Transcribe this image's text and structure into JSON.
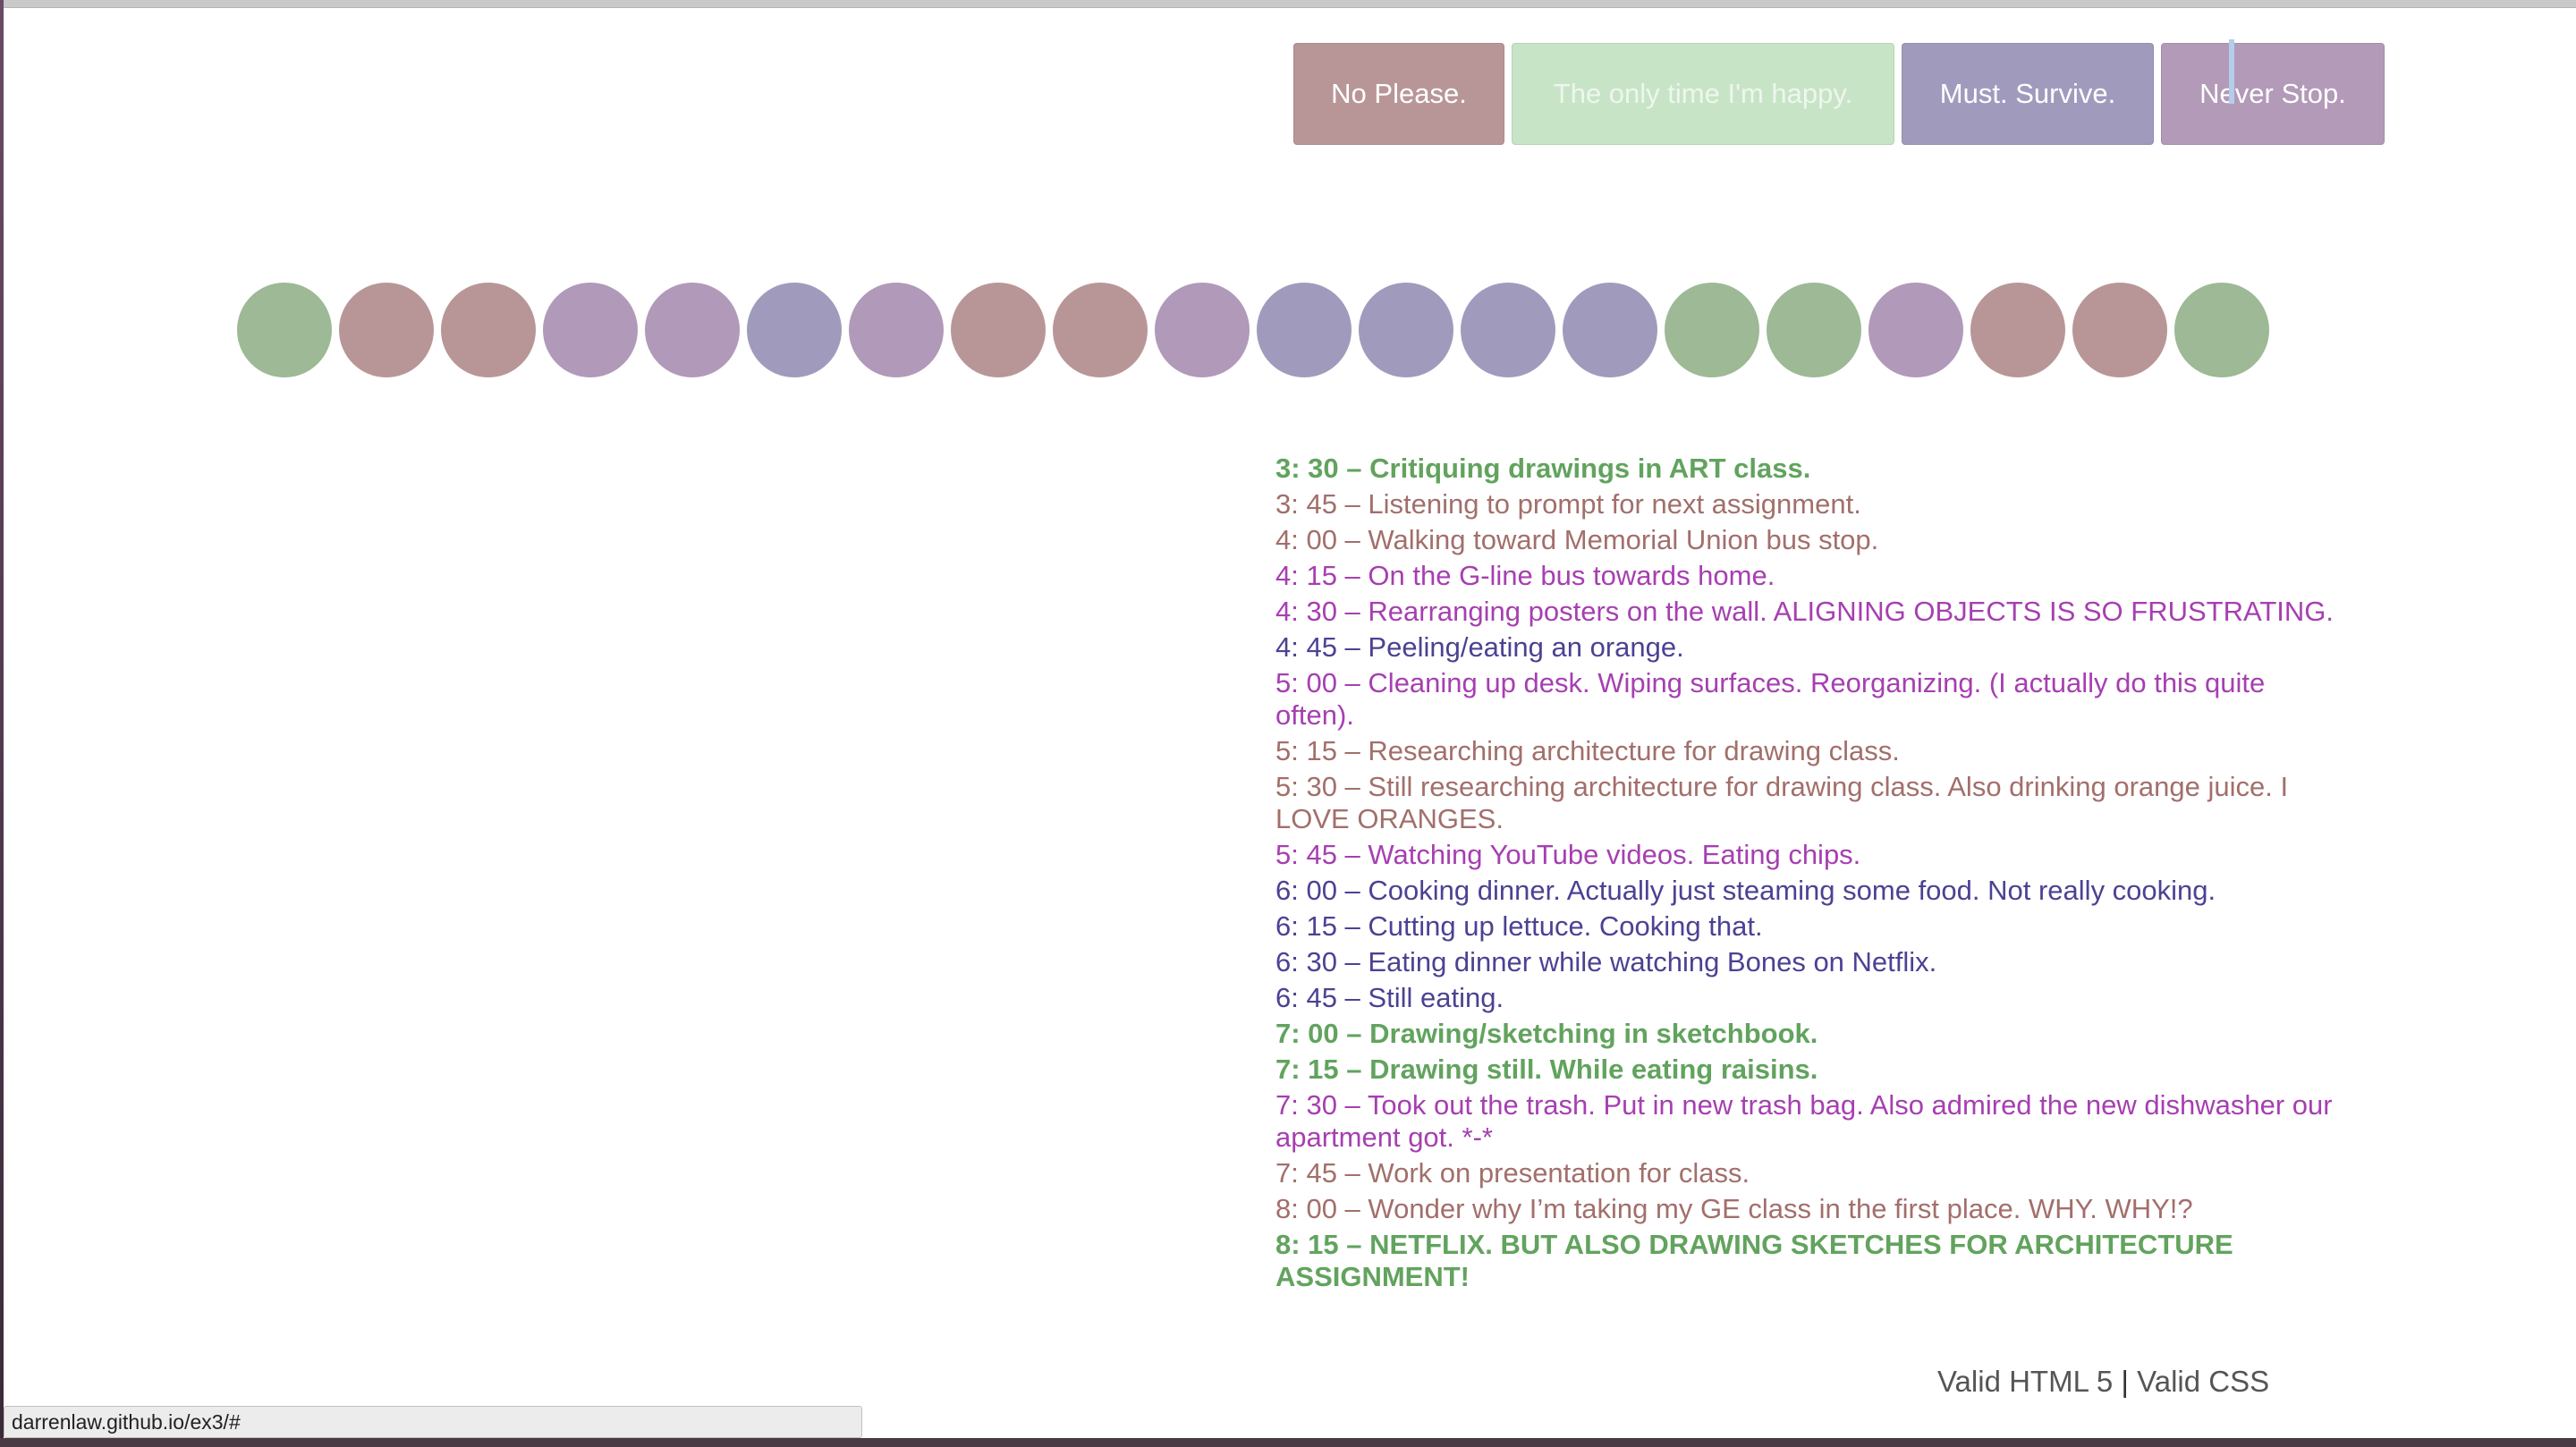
{
  "nav": [
    {
      "label": "No Please."
    },
    {
      "label": "The only time I'm happy."
    },
    {
      "label": "Must. Survive."
    },
    {
      "label": "Never Stop."
    }
  ],
  "colors": {
    "green_dot": "#9db996",
    "rose_dot": "#b89698",
    "purple_dot": "#b199b9",
    "indigo_dot": "#a09bbd",
    "green_text": "#62a35e",
    "rose_text": "#a26f6b",
    "purple_text": "#a63fb1",
    "indigo_text": "#4b4293"
  },
  "dots": [
    "green",
    "rose",
    "rose",
    "purple",
    "purple",
    "indigo",
    "purple",
    "rose",
    "rose",
    "purple",
    "indigo",
    "indigo",
    "indigo",
    "indigo",
    "green",
    "green",
    "purple",
    "rose",
    "rose",
    "green"
  ],
  "log": [
    {
      "text": "3: 30 – Critiquing drawings in ART class.",
      "category": "green"
    },
    {
      "text": "3: 45 – Listening to prompt for next assignment.",
      "category": "rose"
    },
    {
      "text": "4: 00 – Walking toward Memorial Union bus stop.",
      "category": "rose"
    },
    {
      "text": "4: 15 – On the G-line bus towards home.",
      "category": "purple"
    },
    {
      "text": "4: 30 – Rearranging posters on the wall. ALIGNING OBJECTS IS SO FRUSTRATING.",
      "category": "purple"
    },
    {
      "text": "4: 45 – Peeling/eating an orange.",
      "category": "indigo"
    },
    {
      "text": "5: 00 – Cleaning up desk. Wiping surfaces. Reorganizing. (I actually do this quite often).",
      "category": "purple"
    },
    {
      "text": "5: 15 – Researching architecture for drawing class.",
      "category": "rose"
    },
    {
      "text": "5: 30 – Still researching architecture for drawing class. Also drinking orange juice. I LOVE ORANGES.",
      "category": "rose"
    },
    {
      "text": "5: 45 – Watching YouTube videos. Eating chips.",
      "category": "purple"
    },
    {
      "text": "6: 00 – Cooking dinner. Actually just steaming some food. Not really cooking.",
      "category": "indigo"
    },
    {
      "text": "6: 15 – Cutting up lettuce. Cooking that.",
      "category": "indigo"
    },
    {
      "text": "6: 30 – Eating dinner while watching Bones on Netflix.",
      "category": "indigo"
    },
    {
      "text": "6: 45 – Still eating.",
      "category": "indigo"
    },
    {
      "text": "7: 00 – Drawing/sketching in sketchbook.",
      "category": "green"
    },
    {
      "text": "7: 15 – Drawing still. While eating raisins.",
      "category": "green"
    },
    {
      "text": "7: 30 – Took out the trash. Put in new trash bag. Also admired the new dishwasher our apartment got. *-*",
      "category": "purple"
    },
    {
      "text": "7: 45 – Work on presentation for class.",
      "category": "rose"
    },
    {
      "text": "8: 00 – Wonder why I’m taking my GE class in the first place. WHY. WHY!?",
      "category": "rose"
    },
    {
      "text": "8: 15 – NETFLIX. BUT ALSO DRAWING SKETCHES FOR ARCHITECTURE ASSIGNMENT!",
      "category": "green"
    }
  ],
  "footer": {
    "html_link": "Valid HTML 5",
    "separator": "|",
    "css_link": "Valid CSS"
  },
  "status_url": "darrenlaw.github.io/ex3/#"
}
